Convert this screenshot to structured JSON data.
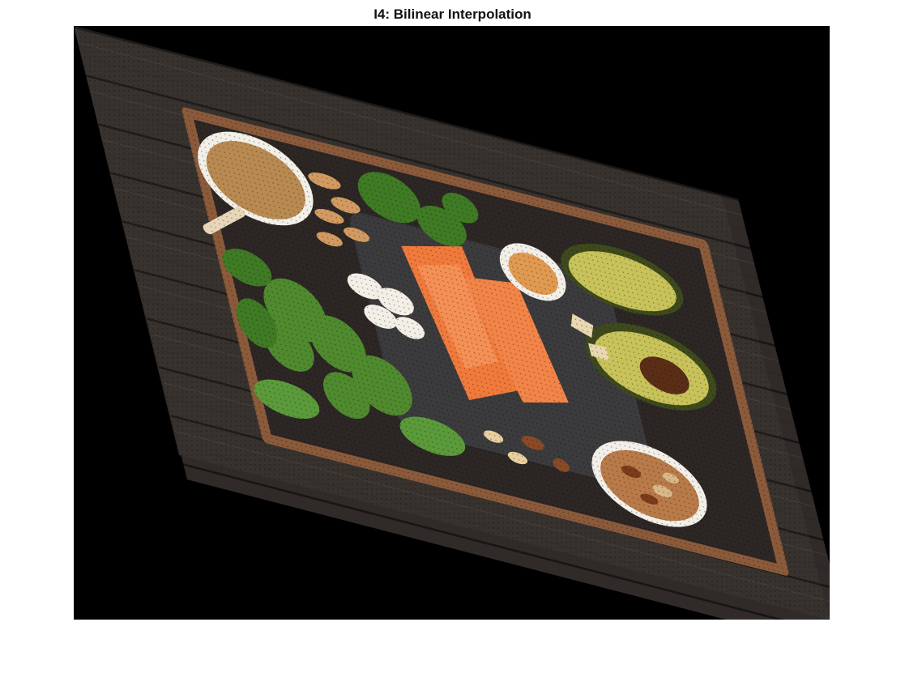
{
  "figure": {
    "title": "I4: Bilinear Interpolation"
  },
  "image": {
    "subject": "sheared photo of a healthy-food tray on a dark wooden table",
    "background_color": "#000000",
    "colors": {
      "wood": "#3a3532",
      "wood_dark": "#2a2624",
      "tray_rim": "#8a5a3a",
      "tray_inner": "#2c2624",
      "slate": "#3a3a3c",
      "salmon": "#f07a3c",
      "salmon_light": "#f7a06a",
      "avocado_skin": "#3e4a1c",
      "avocado_flesh": "#c8c25a",
      "avocado_pit": "#5a2e16",
      "broccoli": "#4f8a2e",
      "spinach": "#3f7a24",
      "kale": "#5a9a3a",
      "nuts": "#c89060",
      "bowl": "#f2efe8",
      "egg": "#e09a50"
    }
  }
}
